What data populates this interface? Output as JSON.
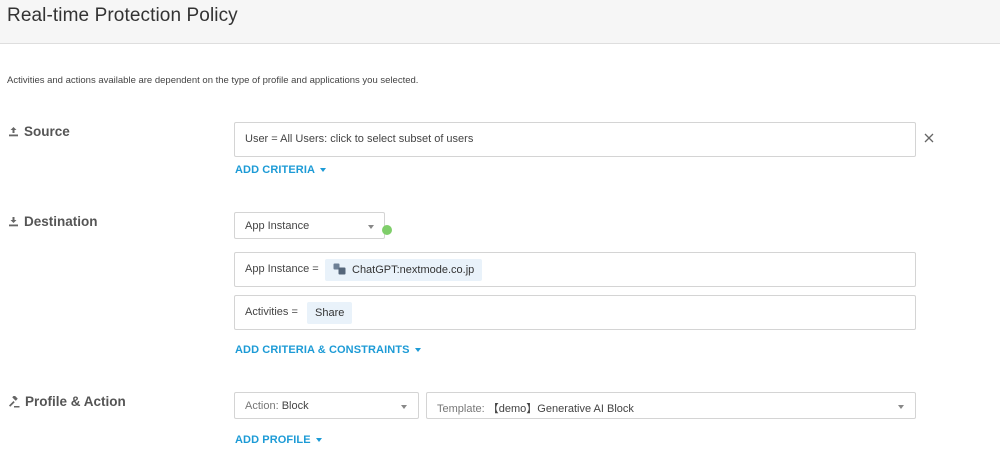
{
  "header": {
    "title": "Real-time Protection Policy"
  },
  "info_text": "Activities and actions available are dependent on the type of profile and applications you selected.",
  "source": {
    "label": "Source",
    "user_field": "User = All Users: click to select subset of users",
    "add_criteria": "ADD CRITERIA"
  },
  "destination": {
    "label": "Destination",
    "select_value": "App Instance",
    "status_color": "#7fce6a",
    "app_instance_prefix": "App Instance =",
    "app_instance_value": "ChatGPT:nextmode.co.jp",
    "activities_prefix": "Activities =",
    "activities_value": "Share",
    "add_criteria_constraints": "ADD CRITERIA & CONSTRAINTS"
  },
  "profile_action": {
    "label": "Profile & Action",
    "action_prefix": "Action:",
    "action_value": "Block",
    "template_prefix": "Template:",
    "template_value": "【demo】Generative AI Block",
    "add_profile": "ADD PROFILE"
  },
  "colors": {
    "accent": "#1d9bd6",
    "header_bg": "#f6f6f6"
  }
}
